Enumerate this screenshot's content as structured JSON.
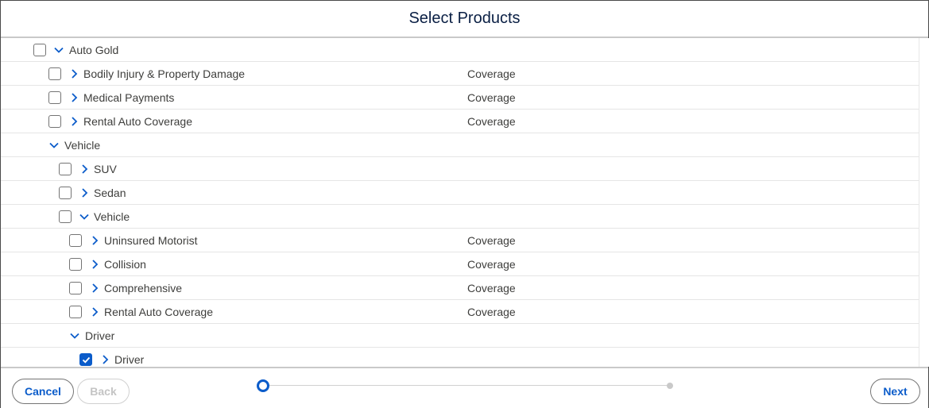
{
  "header": {
    "title": "Select Products"
  },
  "tree": {
    "rows": [
      {
        "label": "Auto Gold",
        "type": "",
        "checkbox": true,
        "checked": false,
        "expanded": true
      },
      {
        "label": "Bodily Injury & Property Damage",
        "type": "Coverage",
        "checkbox": true,
        "checked": false,
        "expanded": false
      },
      {
        "label": "Medical Payments",
        "type": "Coverage",
        "checkbox": true,
        "checked": false,
        "expanded": false
      },
      {
        "label": "Rental Auto Coverage",
        "type": "Coverage",
        "checkbox": true,
        "checked": false,
        "expanded": false
      },
      {
        "label": "Vehicle",
        "type": "",
        "checkbox": false,
        "checked": false,
        "expanded": true
      },
      {
        "label": "SUV",
        "type": "",
        "checkbox": true,
        "checked": false,
        "expanded": false
      },
      {
        "label": "Sedan",
        "type": "",
        "checkbox": true,
        "checked": false,
        "expanded": false
      },
      {
        "label": "Vehicle",
        "type": "",
        "checkbox": true,
        "checked": false,
        "expanded": true
      },
      {
        "label": "Uninsured Motorist",
        "type": "Coverage",
        "checkbox": true,
        "checked": false,
        "expanded": false
      },
      {
        "label": "Collision",
        "type": "Coverage",
        "checkbox": true,
        "checked": false,
        "expanded": false
      },
      {
        "label": "Comprehensive",
        "type": "Coverage",
        "checkbox": true,
        "checked": false,
        "expanded": false
      },
      {
        "label": "Rental Auto Coverage",
        "type": "Coverage",
        "checkbox": true,
        "checked": false,
        "expanded": false
      },
      {
        "label": "Driver",
        "type": "",
        "checkbox": false,
        "checked": false,
        "expanded": true
      },
      {
        "label": "Driver",
        "type": "",
        "checkbox": true,
        "checked": true,
        "expanded": false
      }
    ]
  },
  "footer": {
    "cancel_label": "Cancel",
    "back_label": "Back",
    "next_label": "Next",
    "progress": {
      "current_step": 1,
      "total_steps": 2
    }
  },
  "colors": {
    "accent": "#0b5cca",
    "title": "#0a1f44"
  }
}
